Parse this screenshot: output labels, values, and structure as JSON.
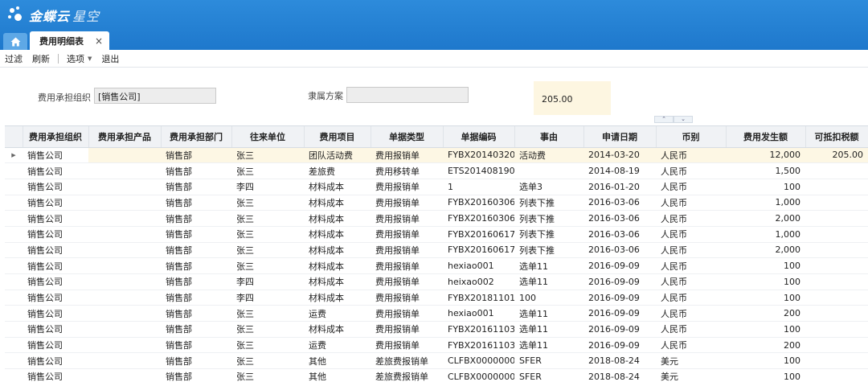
{
  "app": {
    "brand": "金蝶云",
    "brand_sub": "星空"
  },
  "tabs": {
    "active_label": "费用明细表",
    "close_glyph": "×",
    "home_icon": "home-icon"
  },
  "toolbar": {
    "filter": "过滤",
    "refresh": "刷新",
    "options": "选项",
    "exit": "退出"
  },
  "filters": {
    "org_label": "费用承担组织",
    "org_value": "[销售公司]",
    "scheme_label": "隶属方案",
    "scheme_value": "",
    "amount_total": "205.00"
  },
  "grid": {
    "columns": [
      "费用承担组织",
      "费用承担产品",
      "费用承担部门",
      "往来单位",
      "费用项目",
      "单据类型",
      "单据编码",
      "事由",
      "申请日期",
      "币别",
      "费用发生额",
      "可抵扣税额"
    ],
    "rows": [
      [
        "销售公司",
        "",
        "销售部",
        "张三",
        "团队活动费",
        "费用报销单",
        "FYBX2014032000",
        "活动费",
        "2014-03-20",
        "人民币",
        "12,000",
        "205.00"
      ],
      [
        "销售公司",
        "",
        "销售部",
        "张三",
        "差旅费",
        "费用移转单",
        "ETS20140819000",
        "",
        "2014-08-19",
        "人民币",
        "1,500",
        ""
      ],
      [
        "销售公司",
        "",
        "销售部",
        "李四",
        "材料成本",
        "费用报销单",
        "1",
        "选单3",
        "2016-01-20",
        "人民币",
        "100",
        ""
      ],
      [
        "销售公司",
        "",
        "销售部",
        "张三",
        "材料成本",
        "费用报销单",
        "FYBX2016030600",
        "列表下推",
        "2016-03-06",
        "人民币",
        "1,000",
        ""
      ],
      [
        "销售公司",
        "",
        "销售部",
        "张三",
        "材料成本",
        "费用报销单",
        "FYBX2016030600",
        "列表下推",
        "2016-03-06",
        "人民币",
        "2,000",
        ""
      ],
      [
        "销售公司",
        "",
        "销售部",
        "张三",
        "材料成本",
        "费用报销单",
        "FYBX2016061700",
        "列表下推",
        "2016-03-06",
        "人民币",
        "1,000",
        ""
      ],
      [
        "销售公司",
        "",
        "销售部",
        "张三",
        "材料成本",
        "费用报销单",
        "FYBX2016061700",
        "列表下推",
        "2016-03-06",
        "人民币",
        "2,000",
        ""
      ],
      [
        "销售公司",
        "",
        "销售部",
        "张三",
        "材料成本",
        "费用报销单",
        "hexiao001",
        "选单11",
        "2016-09-09",
        "人民币",
        "100",
        ""
      ],
      [
        "销售公司",
        "",
        "销售部",
        "李四",
        "材料成本",
        "费用报销单",
        "heixao002",
        "选单11",
        "2016-09-09",
        "人民币",
        "100",
        ""
      ],
      [
        "销售公司",
        "",
        "销售部",
        "李四",
        "材料成本",
        "费用报销单",
        "FYBX2018110100",
        "100",
        "2016-09-09",
        "人民币",
        "100",
        ""
      ],
      [
        "销售公司",
        "",
        "销售部",
        "张三",
        "运费",
        "费用报销单",
        "hexiao001",
        "选单11",
        "2016-09-09",
        "人民币",
        "200",
        ""
      ],
      [
        "销售公司",
        "",
        "销售部",
        "张三",
        "材料成本",
        "费用报销单",
        "FYBX2016110300",
        "选单11",
        "2016-09-09",
        "人民币",
        "100",
        ""
      ],
      [
        "销售公司",
        "",
        "销售部",
        "张三",
        "运费",
        "费用报销单",
        "FYBX2016110300",
        "选单11",
        "2016-09-09",
        "人民币",
        "200",
        ""
      ],
      [
        "销售公司",
        "",
        "销售部",
        "张三",
        "其他",
        "差旅费报销单",
        "CLFBX00000009",
        "SFER",
        "2018-08-24",
        "美元",
        "100",
        ""
      ],
      [
        "销售公司",
        "",
        "销售部",
        "张三",
        "其他",
        "差旅费报销单",
        "CLFBX00000009",
        "SFER",
        "2018-08-24",
        "美元",
        "100",
        ""
      ]
    ]
  }
}
